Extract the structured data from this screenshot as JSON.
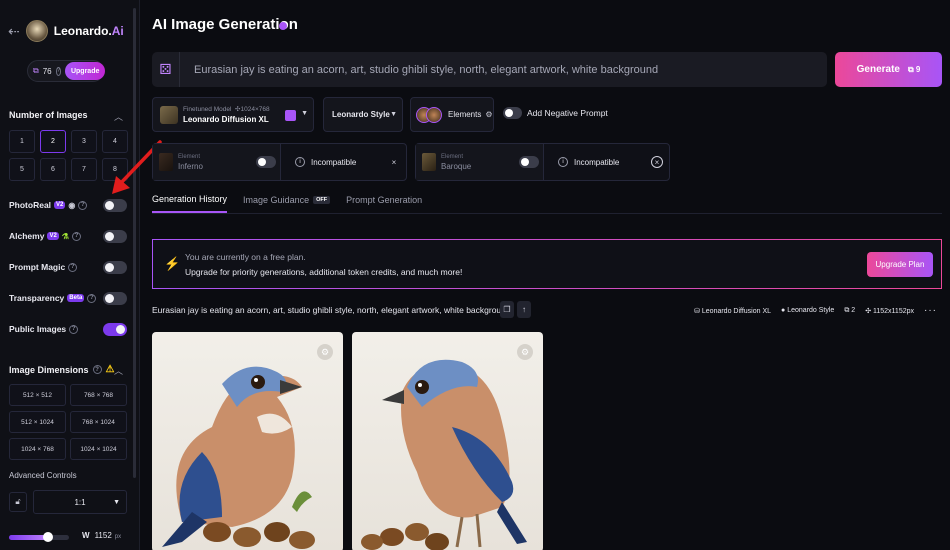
{
  "sidebar": {
    "brand_name": "Leonardo.",
    "brand_ai": "Ai",
    "tokens": "76",
    "upgrade_label": "Upgrade",
    "num_images_title": "Number of Images",
    "num_options": [
      "1",
      "2",
      "3",
      "4",
      "5",
      "6",
      "7",
      "8"
    ],
    "num_selected": "2",
    "options": [
      {
        "label": "PhotoReal",
        "tag": "V2",
        "on": false
      },
      {
        "label": "Alchemy",
        "tag": "V2",
        "on": false
      },
      {
        "label": "Prompt Magic",
        "tag": "",
        "on": false
      },
      {
        "label": "Transparency",
        "tag": "Beta",
        "on": false
      },
      {
        "label": "Public Images",
        "tag": "",
        "on": true
      }
    ],
    "dimensions_title": "Image Dimensions",
    "dimensions": [
      "512 × 512",
      "768 × 768",
      "512 × 1024",
      "768 × 1024",
      "1024 × 768",
      "1024 × 1024"
    ],
    "advanced_controls": "Advanced Controls",
    "aspect_ratio": "1:1",
    "width_label": "W",
    "width_value": "1152",
    "width_unit": "px"
  },
  "main": {
    "title": "AI Image Generation",
    "prompt": "Eurasian jay is eating an acorn, art, studio ghibli style, north, elegant artwork, white background",
    "generate_label": "Generate",
    "generate_tokens": "9",
    "model_small": "Finetuned Model",
    "model_dims": "1024×768",
    "model_name": "Leonardo Diffusion XL",
    "style": "Leonardo Style",
    "elements_label": "Elements",
    "negative_prompt_label": "Add Negative Prompt",
    "element_cards": [
      {
        "small": "Element",
        "name": "Inferno",
        "status": "Incompatible"
      },
      {
        "small": "Element",
        "name": "Baroque",
        "status": "Incompatible"
      }
    ],
    "tabs": [
      {
        "label": "Generation History",
        "active": true
      },
      {
        "label": "Image Guidance",
        "badge": "OFF",
        "active": false
      },
      {
        "label": "Prompt Generation",
        "active": false
      }
    ],
    "banner_line1": "You are currently on a free plan.",
    "banner_line2": "Upgrade for priority generations, additional token credits, and much more!",
    "upgrade_plan_label": "Upgrade Plan",
    "generation_prompt": "Eurasian jay is eating an acorn, art, studio ghibli style, north, elegant artwork, white background",
    "gen_meta": {
      "model": "Leonardo Diffusion XL",
      "style": "Leonardo Style",
      "count": "2",
      "size": "1152x1152px"
    }
  },
  "colors": {
    "accent": "#a855f7",
    "pink": "#ec4899",
    "bg": "#0b0c11"
  }
}
